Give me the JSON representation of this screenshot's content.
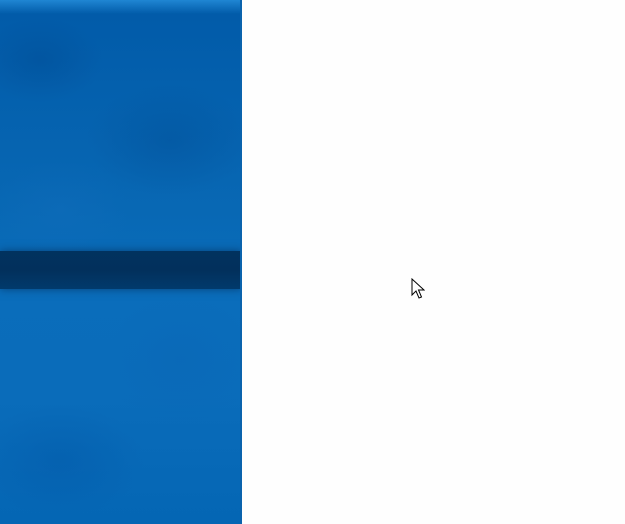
{
  "screen": {
    "wallpaper": {
      "base_color": "#0a6cba",
      "band_color": "#02305c"
    },
    "blank_area": {
      "background_color": "#fefefe"
    },
    "cursor": {
      "icon": "arrow-pointer-icon"
    }
  }
}
